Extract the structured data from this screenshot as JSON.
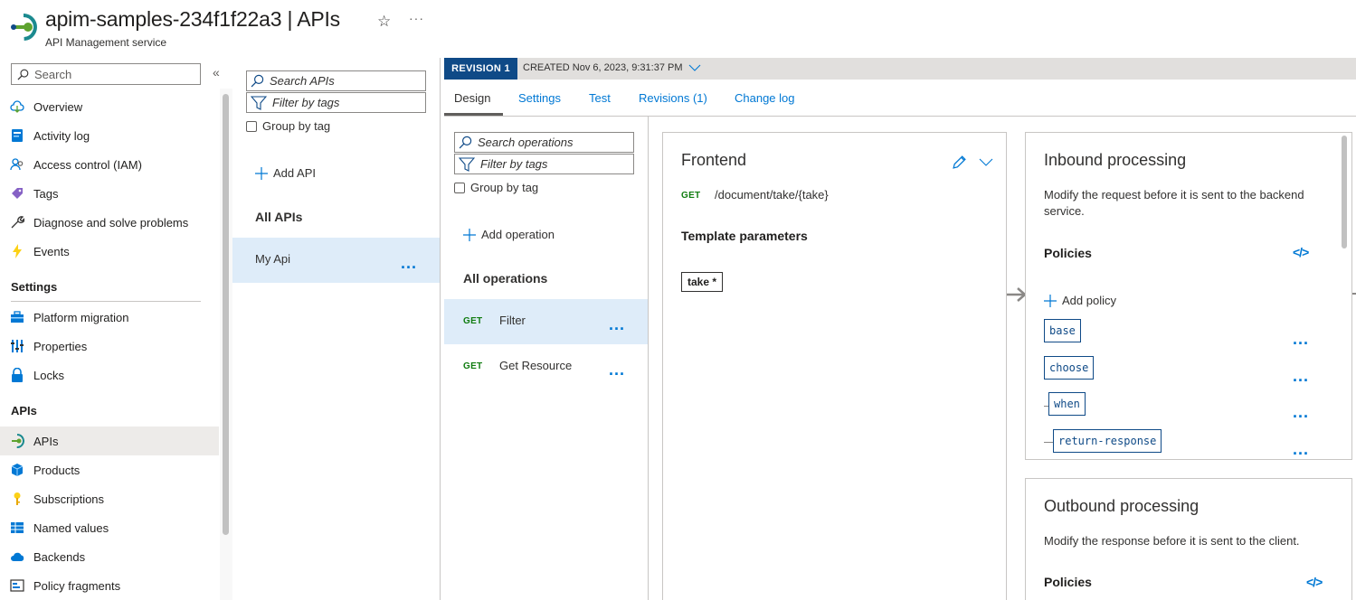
{
  "header": {
    "title": "apim-samples-234f1f22a3 | APIs",
    "subtitle": "API Management service",
    "more": "···"
  },
  "nav": {
    "search_placeholder": "Search",
    "items_top": [
      {
        "label": "Overview",
        "icon": "cloud-icon"
      },
      {
        "label": "Activity log",
        "icon": "log-icon"
      },
      {
        "label": "Access control (IAM)",
        "icon": "people-icon"
      },
      {
        "label": "Tags",
        "icon": "tag-icon"
      },
      {
        "label": "Diagnose and solve problems",
        "icon": "wrench-icon"
      },
      {
        "label": "Events",
        "icon": "lightning-icon"
      }
    ],
    "settings_heading": "Settings",
    "items_settings": [
      {
        "label": "Platform migration",
        "icon": "toolbox-icon"
      },
      {
        "label": "Properties",
        "icon": "bars-icon"
      },
      {
        "label": "Locks",
        "icon": "lock-icon"
      }
    ],
    "apis_heading": "APIs",
    "items_apis": [
      {
        "label": "APIs",
        "icon": "apim-icon",
        "selected": true
      },
      {
        "label": "Products",
        "icon": "cube-icon"
      },
      {
        "label": "Subscriptions",
        "icon": "key-icon"
      },
      {
        "label": "Named values",
        "icon": "grid-icon"
      },
      {
        "label": "Backends",
        "icon": "cloud-backend-icon"
      },
      {
        "label": "Policy fragments",
        "icon": "fragment-icon"
      }
    ]
  },
  "apis_panel": {
    "search_placeholder": "Search APIs",
    "filter_placeholder": "Filter by tags",
    "group_by_tag": "Group by tag",
    "add_api": "Add API",
    "all_apis": "All APIs",
    "apis": [
      {
        "name": "My Api",
        "selected": true
      }
    ],
    "more": "..."
  },
  "revision": {
    "badge": "REVISION 1",
    "created": "CREATED Nov 6, 2023, 9:31:37 PM"
  },
  "tabs": [
    {
      "label": "Design",
      "active": true
    },
    {
      "label": "Settings"
    },
    {
      "label": "Test"
    },
    {
      "label": "Revisions (1)"
    },
    {
      "label": "Change log"
    }
  ],
  "operations_panel": {
    "search_placeholder": "Search operations",
    "filter_placeholder": "Filter by tags",
    "group_by_tag": "Group by tag",
    "add_operation": "Add operation",
    "all_operations": "All operations",
    "operations": [
      {
        "method": "GET",
        "name": "Filter",
        "selected": true
      },
      {
        "method": "GET",
        "name": "Get Resource"
      }
    ],
    "more": "..."
  },
  "frontend": {
    "title": "Frontend",
    "method": "GET",
    "path": "/document/take/{take}",
    "template_params_heading": "Template parameters",
    "params": [
      "take *"
    ]
  },
  "inbound": {
    "title": "Inbound processing",
    "description": "Modify the request before it is sent to the backend service.",
    "policies_heading": "Policies",
    "code_icon": "</>",
    "add_policy": "Add policy",
    "policies": [
      "base",
      "choose",
      "when",
      "return-response"
    ],
    "more": "..."
  },
  "outbound": {
    "title": "Outbound processing",
    "description": "Modify the response before it is sent to the client.",
    "policies_heading": "Policies",
    "code_icon": "</>"
  },
  "colors": {
    "accent": "#0078d4",
    "revision_badge": "#0f4a87",
    "get_method": "#107c10",
    "selected_row": "#deecf9"
  }
}
